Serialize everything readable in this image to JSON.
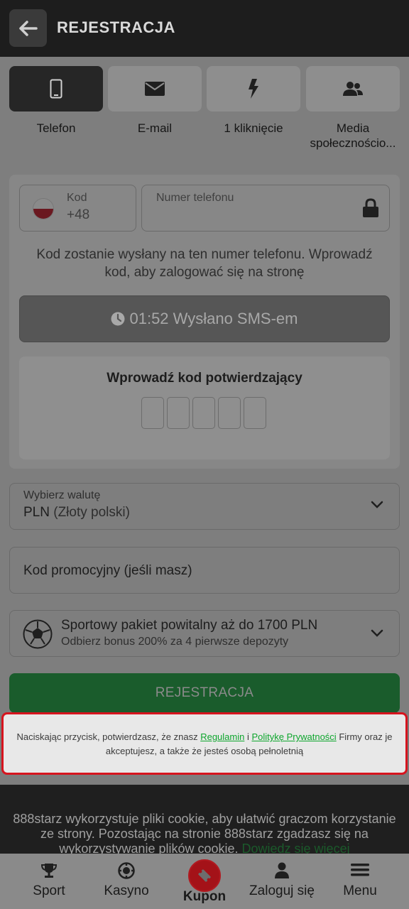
{
  "header": {
    "title": "REJESTRACJA"
  },
  "tabs": [
    {
      "label": "Telefon",
      "icon": "phone-icon",
      "active": true
    },
    {
      "label": "E-mail",
      "icon": "envelope-icon",
      "active": false
    },
    {
      "label": "1 kliknięcie",
      "icon": "lightning-icon",
      "active": false
    },
    {
      "label": "Media społecznościo...",
      "icon": "users-icon",
      "active": false
    }
  ],
  "phone_form": {
    "code_label": "Kod",
    "code_value": "+48",
    "phone_placeholder": "Numer telefonu",
    "hint": "Kod zostanie wysłany na ten numer telefonu. Wprowadź kod, aby zalogować się na stronę",
    "sms_button": "01:52 Wysłano SMS-em",
    "verify_title": "Wprowadź kod potwierdzający"
  },
  "currency": {
    "label": "Wybierz walutę",
    "code": "PLN",
    "name": "(Złoty polski)"
  },
  "promo": {
    "placeholder": "Kod promocyjny (jeśli masz)"
  },
  "bonus": {
    "title": "Sportowy pakiet powitalny aż do 1700 PLN",
    "subtitle": "Odbierz bonus 200% za 4 pierwsze depozyty"
  },
  "register_button": "REJESTRACJA",
  "consent": {
    "part1": "Naciskając przycisk, potwierdzasz, że znasz ",
    "link1": "Regulamin",
    "part2": " i ",
    "link2": "Politykę Prywatności",
    "part3": " Firmy oraz je akceptujesz, a także że jesteś osobą pełnoletnią"
  },
  "cookie": {
    "text": "888starz wykorzystuje pliki cookie, aby ułatwić graczom korzystanie ze strony. Pozostając na stronie 888starz zgadzasz się na wykorzystywanie plików cookie. ",
    "link": "Dowiedz się więcej"
  },
  "bottom_nav": [
    {
      "label": "Sport",
      "icon": "trophy-icon"
    },
    {
      "label": "Kasyno",
      "icon": "casino-chip-icon"
    },
    {
      "label": "Kupon",
      "icon": "ticket-icon"
    },
    {
      "label": "Zaloguj się",
      "icon": "user-icon"
    },
    {
      "label": "Menu",
      "icon": "hamburger-icon"
    }
  ],
  "colors": {
    "header_bg": "#1d1d1d",
    "accent_green": "#0fa62e",
    "highlight_red": "#d6141e",
    "kupon_red": "#a41218"
  }
}
